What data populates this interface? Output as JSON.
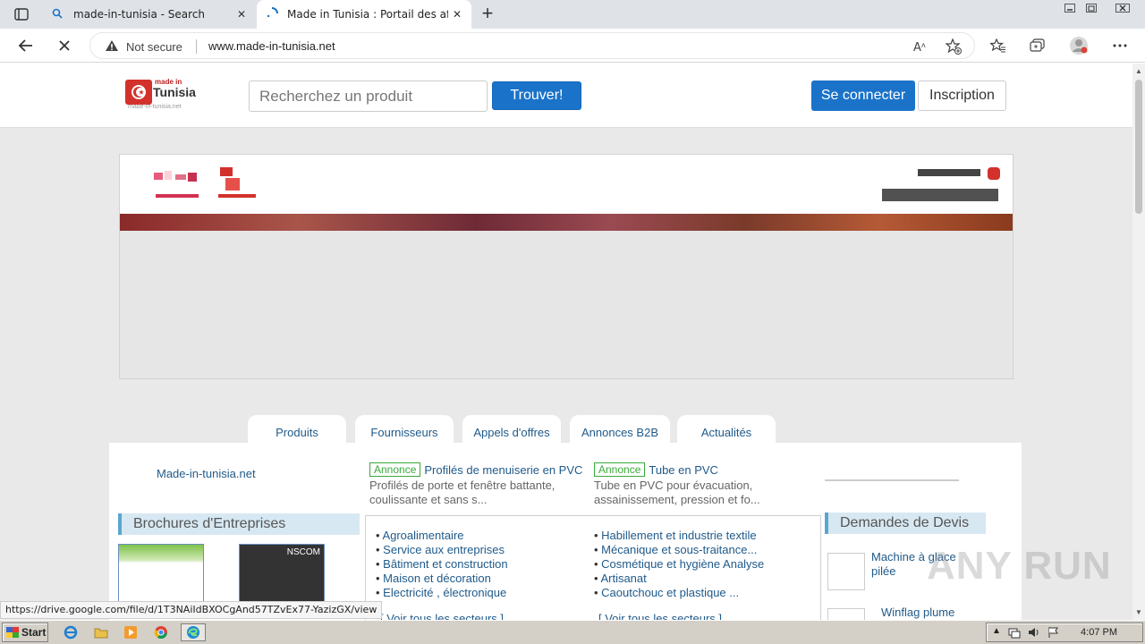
{
  "browser": {
    "tabs": [
      {
        "title": "made-in-tunisia - Search",
        "icon": "search-icon"
      },
      {
        "title": "Made in Tunisia : Portail des affair",
        "icon": "loading-icon"
      }
    ],
    "address": {
      "security_label": "Not secure",
      "url": "www.made-in-tunisia.net"
    }
  },
  "header": {
    "logo": {
      "small": "made in",
      "main": "Tunisia",
      "sub": "made-in-tunisia.net"
    },
    "search_placeholder": "Recherchez un produit",
    "search_button": "Trouver!",
    "login_button": "Se connecter",
    "signup_button": "Inscription"
  },
  "page_tabs": [
    "Produits",
    "Fournisseurs",
    "Appels d'offres",
    "Annonces B2B",
    "Actualités"
  ],
  "site_link": "Made-in-tunisia.net",
  "ads": [
    {
      "badge": "Annonce",
      "title": "Profilés de menuiserie en PVC",
      "desc": "Profilés de porte et fenêtre battante, coulissante et sans s..."
    },
    {
      "badge": "Annonce",
      "title": "Tube en PVC",
      "desc": "Tube en PVC pour évacuation, assainissement, pression et fo..."
    }
  ],
  "brochures": {
    "heading": "Brochures d'Entreprises",
    "items": [
      {
        "label": ""
      },
      {
        "label": "NSCOM"
      }
    ]
  },
  "sectors": {
    "left": [
      "Agroalimentaire",
      "Service aux entreprises",
      "Bâtiment et construction",
      "Maison et décoration",
      "Electricité , électronique"
    ],
    "right": [
      "Habillement et industrie textile",
      "Mécanique et sous-traitance...",
      "Cosmétique et hygiène Analyse",
      "Artisanat",
      "Caoutchouc et plastique ..."
    ],
    "see_all": "[ Voir tous les secteurs ]"
  },
  "quotes": {
    "heading": "Demandes de Devis",
    "items": [
      "Machine à glace pilée",
      "Winflag plume"
    ]
  },
  "status_url": "https://drive.google.com/file/d/1T3NAiIdBXOCgAnd57TZvEx77-YazizGX/view",
  "watermark": "ANY RUN",
  "taskbar": {
    "start": "Start",
    "clock": "4:07 PM"
  }
}
